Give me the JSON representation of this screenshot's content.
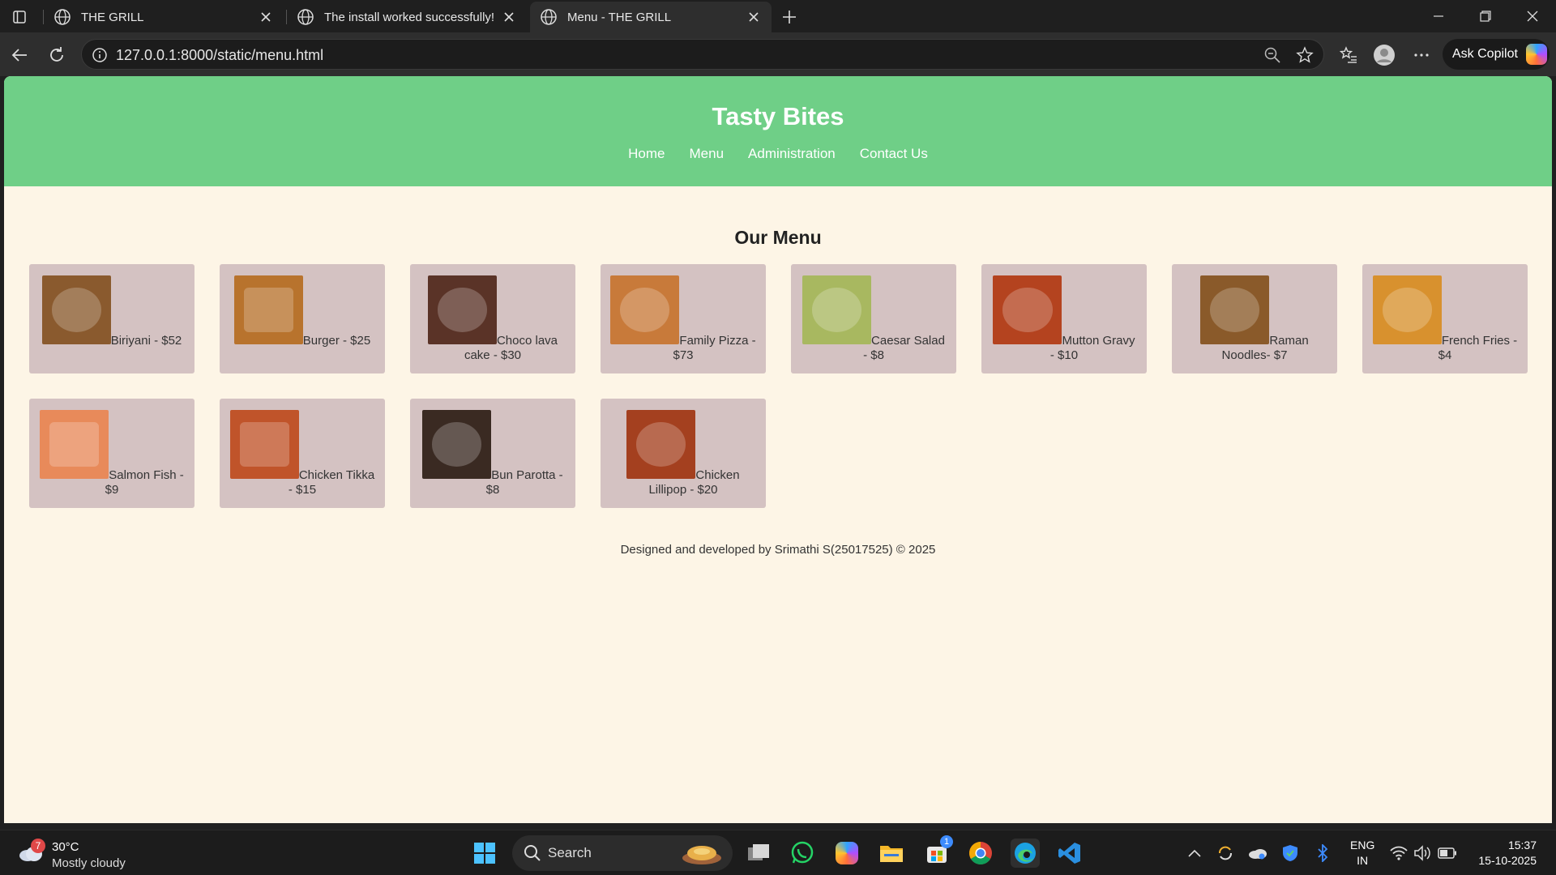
{
  "browser": {
    "tabs": [
      {
        "title": "THE GRILL",
        "active": false
      },
      {
        "title": "The install worked successfully! Co",
        "active": false
      },
      {
        "title": "Menu - THE GRILL",
        "active": true
      }
    ],
    "url": "127.0.0.1:8000/static/menu.html",
    "copilot_label": "Ask Copilot"
  },
  "site": {
    "title": "Tasty Bites",
    "nav": [
      "Home",
      "Menu",
      "Administration",
      "Contact Us"
    ],
    "heading": "Our Menu",
    "items": [
      {
        "label": "Biriyani - $52",
        "image": "biriyani-image",
        "color": "#8a5a2e"
      },
      {
        "label": "Burger - $25",
        "image": "burger-image",
        "color": "#b8732d"
      },
      {
        "label": "Choco lava cake - $30",
        "image": "choco-lava-cake-image",
        "color": "#5a3327"
      },
      {
        "label": "Family Pizza - $73",
        "image": "family-pizza-image",
        "color": "#c87a3a"
      },
      {
        "label": "Caesar Salad - $8",
        "image": "caesar-salad-image",
        "color": "#a8b860"
      },
      {
        "label": "Mutton Gravy - $10",
        "image": "mutton-gravy-image",
        "color": "#b4431f"
      },
      {
        "label": "Raman Noodles- $7",
        "image": "raman-noodles-image",
        "color": "#8a5a2a"
      },
      {
        "label": "French Fries - $4",
        "image": "french-fries-image",
        "color": "#d8912e"
      },
      {
        "label": "Salmon Fish - $9",
        "image": "salmon-fish-image",
        "color": "#e88a5a"
      },
      {
        "label": "Chicken Tikka - $15",
        "image": "chicken-tikka-image",
        "color": "#c0542a"
      },
      {
        "label": "Bun Parotta - $8",
        "image": "bun-parotta-image",
        "color": "#3a2a22"
      },
      {
        "label": "Chicken Lillipop - $20",
        "image": "chicken-lillipop-image",
        "color": "#a4401f"
      }
    ],
    "footer": "Designed and developed by Srimathi S(25017525) © 2025",
    "header_color": "#6fcf87",
    "page_bg": "#fdf5e6",
    "card_bg": "#d4c2c2"
  },
  "taskbar": {
    "weather": {
      "temp": "30°C",
      "condition": "Mostly cloudy",
      "badge": "7"
    },
    "search_label": "Search",
    "store_badge": "1",
    "lang_top": "ENG",
    "lang_bottom": "IN",
    "time": "15:37",
    "date": "15-10-2025"
  }
}
